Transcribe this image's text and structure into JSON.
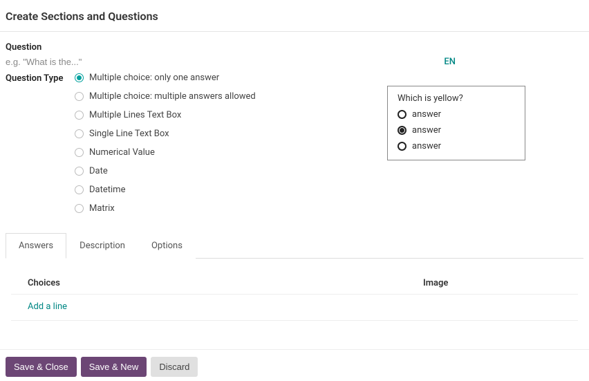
{
  "page_title": "Create Sections and Questions",
  "question": {
    "label": "Question",
    "placeholder": "e.g. \"What is the...\"",
    "value": ""
  },
  "language_tag": "EN",
  "question_type": {
    "label": "Question Type",
    "options": [
      {
        "label": "Multiple choice: only one answer",
        "selected": true
      },
      {
        "label": "Multiple choice: multiple answers allowed",
        "selected": false
      },
      {
        "label": "Multiple Lines Text Box",
        "selected": false
      },
      {
        "label": "Single Line Text Box",
        "selected": false
      },
      {
        "label": "Numerical Value",
        "selected": false
      },
      {
        "label": "Date",
        "selected": false
      },
      {
        "label": "Datetime",
        "selected": false
      },
      {
        "label": "Matrix",
        "selected": false
      }
    ]
  },
  "preview": {
    "question": "Which is yellow?",
    "answers": [
      {
        "label": "answer",
        "selected": false
      },
      {
        "label": "answer",
        "selected": true
      },
      {
        "label": "answer",
        "selected": false
      }
    ]
  },
  "tabs": [
    {
      "label": "Answers",
      "active": true
    },
    {
      "label": "Description",
      "active": false
    },
    {
      "label": "Options",
      "active": false
    }
  ],
  "table": {
    "headers": {
      "choices": "Choices",
      "image": "Image"
    },
    "add_line": "Add a line"
  },
  "buttons": {
    "save_close": "Save & Close",
    "save_new": "Save & New",
    "discard": "Discard"
  }
}
